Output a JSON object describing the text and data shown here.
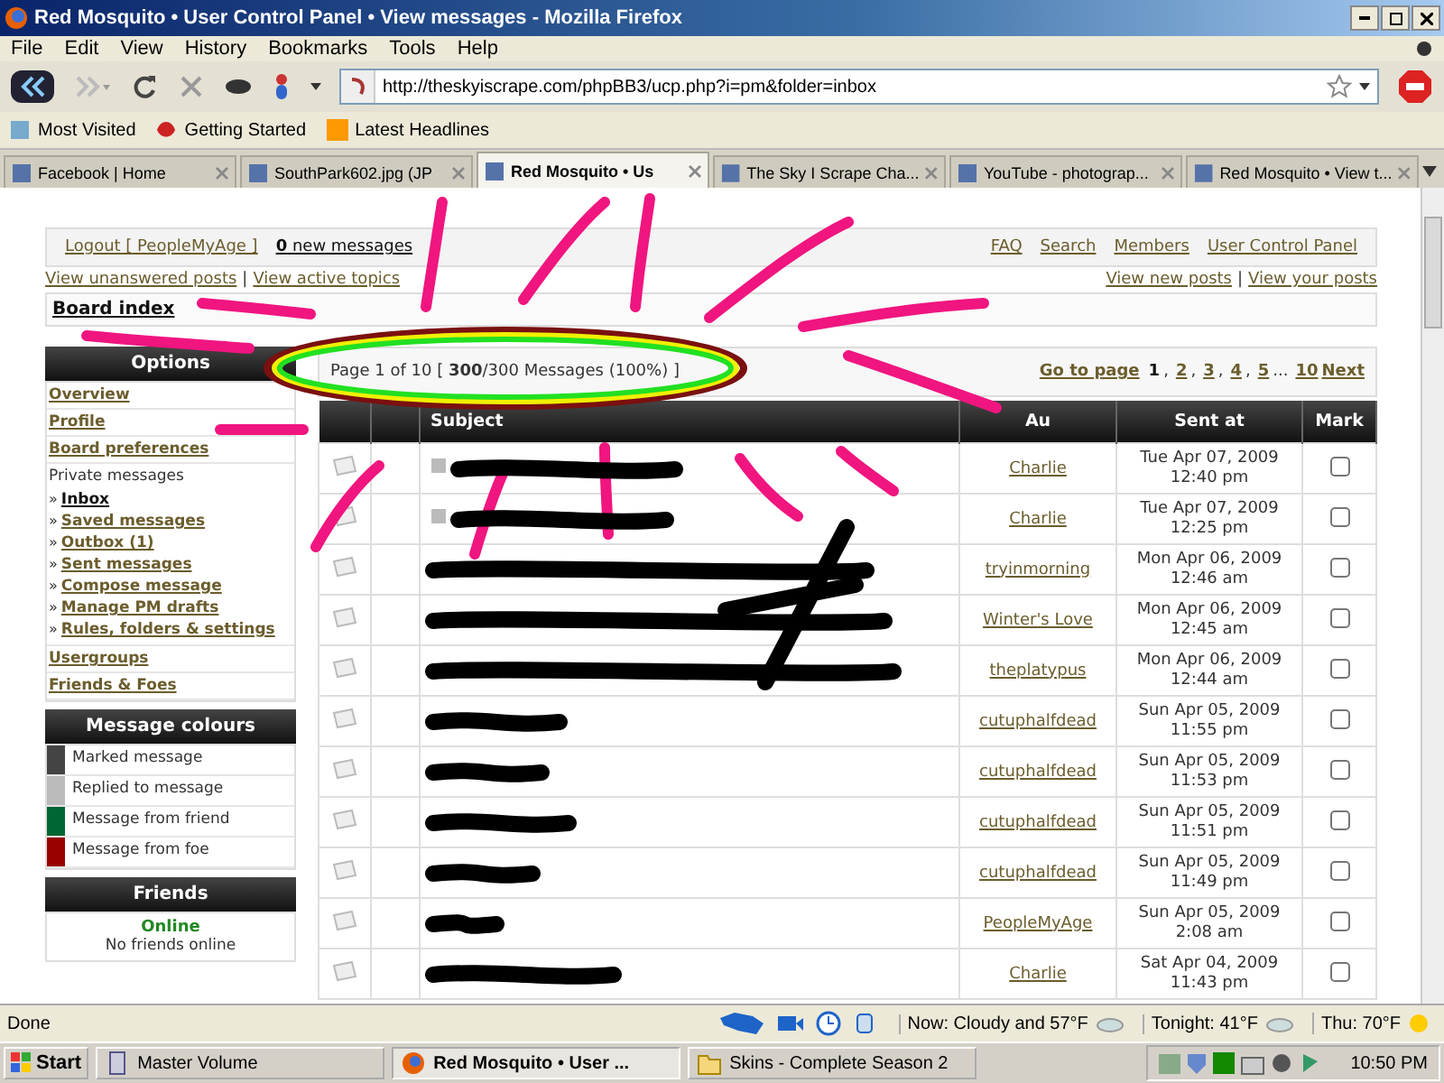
{
  "window": {
    "title": "Red Mosquito • User Control Panel • View messages - Mozilla Firefox"
  },
  "menu": [
    "File",
    "Edit",
    "View",
    "History",
    "Bookmarks",
    "Tools",
    "Help"
  ],
  "address_bar": {
    "value": "http://theskyiscrape.com/phpBB3/ucp.php?i=pm&folder=inbox"
  },
  "bookmarks": [
    "Most Visited",
    "Getting Started",
    "Latest Headlines"
  ],
  "tabs": [
    {
      "label": "Facebook | Home",
      "selected": false
    },
    {
      "label": "SouthPark602.jpg (JP",
      "selected": false
    },
    {
      "label": "Red Mosquito • Us",
      "selected": true
    },
    {
      "label": "The Sky I Scrape Cha...",
      "selected": false
    },
    {
      "label": "YouTube - photograp...",
      "selected": false
    },
    {
      "label": "Red Mosquito • View t...",
      "selected": false
    }
  ],
  "header": {
    "logout": "Logout [ PeopleMyAge ]",
    "new_messages": "**0** new messages",
    "links": [
      "FAQ",
      "Search",
      "Members",
      "User Control Panel"
    ]
  },
  "quick_links_left": [
    {
      "kind": "link",
      "text": "View unanswered posts"
    },
    {
      "kind": "separator",
      "text": "|"
    },
    {
      "kind": "link",
      "text": "View active topics"
    }
  ],
  "quick_links_right": [
    {
      "kind": "link",
      "text": "View new posts"
    },
    {
      "kind": "separator",
      "text": "|"
    },
    {
      "kind": "link",
      "text": "View your posts"
    }
  ],
  "breadcrumb": "Board index",
  "sidebar": {
    "title": "Options",
    "items": [
      {
        "kind": "link",
        "text": "Overview",
        "selected": false
      },
      {
        "kind": "link",
        "text": "Profile",
        "selected": false
      },
      {
        "kind": "link",
        "text": "Board preferences",
        "selected": false
      },
      {
        "kind": "heading",
        "text": "Private messages",
        "children": [
          {
            "bullet": "»",
            "text": "Inbox",
            "selected": true
          },
          {
            "bullet": "»",
            "text": "Saved messages",
            "selected": false
          },
          {
            "bullet": "»",
            "text": "Outbox (1)",
            "selected": false
          },
          {
            "bullet": "»",
            "text": "Sent messages",
            "selected": false
          },
          {
            "bullet": "»",
            "text": "Compose message",
            "selected": false
          },
          {
            "bullet": "»",
            "text": "Manage PM drafts",
            "selected": false
          },
          {
            "bullet": "»",
            "text": "Rules, folders & settings",
            "selected": false
          }
        ]
      },
      {
        "kind": "link",
        "text": "Usergroups",
        "selected": false
      },
      {
        "kind": "link",
        "text": "Friends & Foes",
        "selected": false
      }
    ]
  },
  "legend": {
    "title": "Message colours",
    "items": [
      {
        "label": "Marked message",
        "color": "#444444"
      },
      {
        "label": "Replied to message",
        "color": "#bbbbbb"
      },
      {
        "label": "Message from friend",
        "color": "#006633"
      },
      {
        "label": "Message from foe",
        "color": "#990000"
      }
    ]
  },
  "friends": {
    "title": "Friends",
    "status": "Online",
    "note": "No friends online"
  },
  "pagination": {
    "summary": "Page 1 of 10 [ **300**/300 Messages (100%) ]",
    "goto_label": "Go to page",
    "items": [
      {
        "kind": "page",
        "text": "1",
        "selected": true
      },
      {
        "kind": "separator",
        "text": ","
      },
      {
        "kind": "page",
        "text": "2",
        "selected": false
      },
      {
        "kind": "separator",
        "text": ","
      },
      {
        "kind": "page",
        "text": "3",
        "selected": false
      },
      {
        "kind": "separator",
        "text": ","
      },
      {
        "kind": "page",
        "text": "4",
        "selected": false
      },
      {
        "kind": "separator",
        "text": ","
      },
      {
        "kind": "page",
        "text": "5",
        "selected": false
      },
      {
        "kind": "separator",
        "text": "..."
      },
      {
        "kind": "page",
        "text": "10",
        "selected": false
      },
      {
        "kind": "page",
        "text": "Next",
        "selected": false
      }
    ]
  },
  "table": {
    "columns": {
      "subject": "Subject",
      "author": "Au",
      "sent": "Sent at",
      "mark": "Mark"
    },
    "rows": [
      {
        "author": "Charlie",
        "date": "Tue Apr 07, 2009",
        "time": "12:40 pm",
        "unread_marker": true,
        "marked": false
      },
      {
        "author": "Charlie",
        "date": "Tue Apr 07, 2009",
        "time": "12:25 pm",
        "unread_marker": true,
        "marked": false
      },
      {
        "author": "tryinmorning",
        "date": "Mon Apr 06, 2009",
        "time": "12:46 am",
        "unread_marker": false,
        "marked": false
      },
      {
        "author": "Winter's Love",
        "date": "Mon Apr 06, 2009",
        "time": "12:45 am",
        "unread_marker": false,
        "marked": false
      },
      {
        "author": "theplatypus",
        "date": "Mon Apr 06, 2009",
        "time": "12:44 am",
        "unread_marker": false,
        "marked": false
      },
      {
        "author": "cutuphalfdead",
        "date": "Sun Apr 05, 2009",
        "time": "11:55 pm",
        "unread_marker": false,
        "marked": false
      },
      {
        "author": "cutuphalfdead",
        "date": "Sun Apr 05, 2009",
        "time": "11:53 pm",
        "unread_marker": false,
        "marked": false
      },
      {
        "author": "cutuphalfdead",
        "date": "Sun Apr 05, 2009",
        "time": "11:51 pm",
        "unread_marker": false,
        "marked": false
      },
      {
        "author": "cutuphalfdead",
        "date": "Sun Apr 05, 2009",
        "time": "11:49 pm",
        "unread_marker": false,
        "marked": false
      },
      {
        "author": "PeopleMyAge",
        "date": "Sun Apr 05, 2009",
        "time": "2:08 am",
        "unread_marker": false,
        "marked": false
      },
      {
        "author": "Charlie",
        "date": "Sat Apr 04, 2009",
        "time": "11:43 pm",
        "unread_marker": false,
        "marked": false
      }
    ]
  },
  "status_bar": {
    "text": "Done",
    "weather": [
      "Now: Cloudy and 57°F",
      "Tonight: 41°F",
      "Thu: 70°F"
    ]
  },
  "taskbar": {
    "start": "Start",
    "buttons": [
      {
        "label": "Master Volume",
        "selected": false
      },
      {
        "label": "Red Mosquito • User ...",
        "selected": true
      },
      {
        "label": "Skins - Complete Season 2",
        "selected": false
      }
    ],
    "clock": "10:50 PM"
  }
}
